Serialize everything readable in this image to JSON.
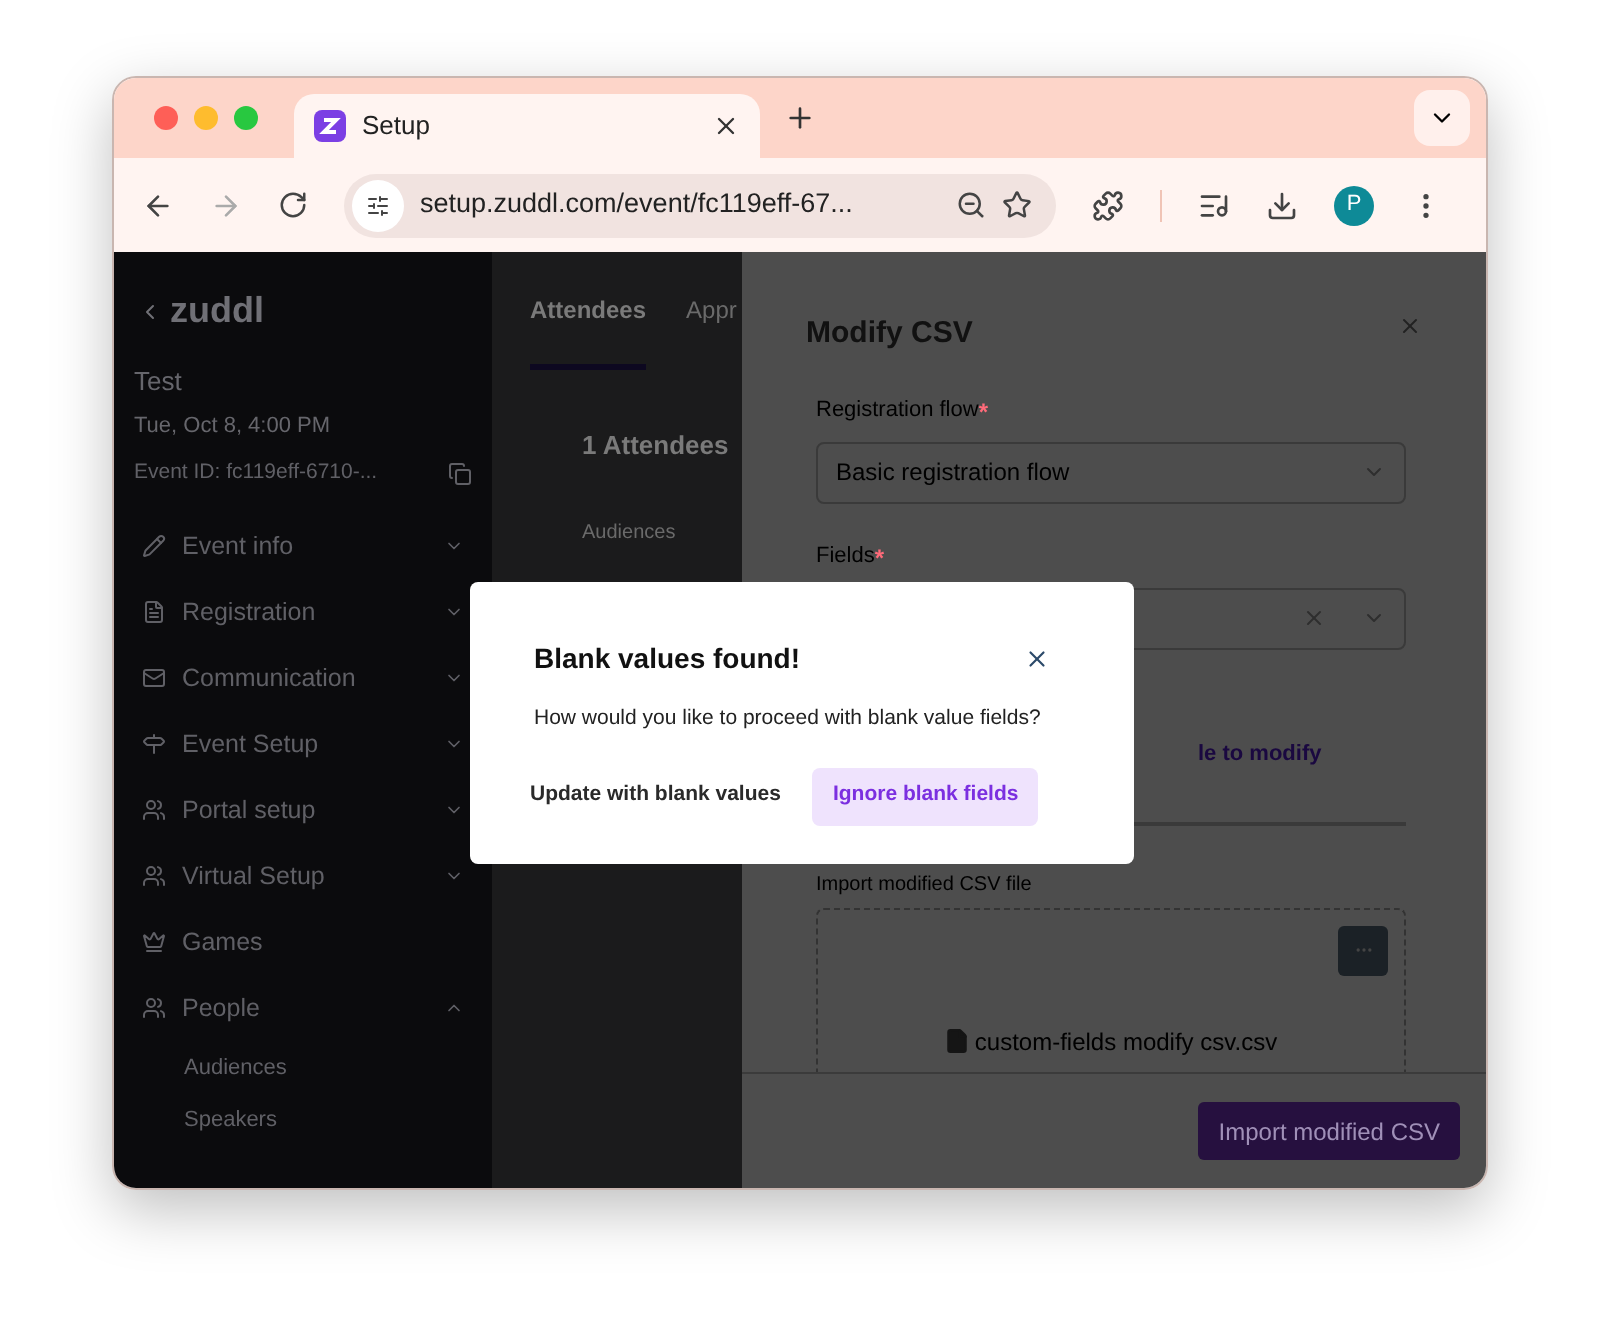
{
  "browser": {
    "tab": {
      "title": "Setup"
    },
    "address": "setup.zuddl.com/event/fc119eff-67...",
    "avatar": "P"
  },
  "sidebar": {
    "logo": "zuddl",
    "event": {
      "name": "Test",
      "date": "Tue, Oct 8, 4:00 PM",
      "id": "Event ID: fc119eff-6710-..."
    },
    "items": [
      {
        "label": "Event info",
        "kind": "group",
        "expanded": false
      },
      {
        "label": "Registration",
        "kind": "group",
        "expanded": false
      },
      {
        "label": "Communication",
        "kind": "group",
        "expanded": false
      },
      {
        "label": "Event Setup",
        "kind": "group",
        "expanded": false
      },
      {
        "label": "Portal setup",
        "kind": "group",
        "expanded": false
      },
      {
        "label": "Virtual Setup",
        "kind": "group",
        "expanded": false
      },
      {
        "label": "Games",
        "kind": "link"
      },
      {
        "label": "People",
        "kind": "group",
        "expanded": true,
        "children": [
          {
            "label": "Audiences"
          },
          {
            "label": "Speakers"
          }
        ]
      }
    ]
  },
  "main": {
    "tabs": [
      {
        "label": "Attendees",
        "selected": true
      },
      {
        "label": "Appr",
        "selected": false
      }
    ],
    "heading": "1 Attendees",
    "filter_label": "Audiences"
  },
  "drawer": {
    "title": "Modify CSV",
    "fields": [
      {
        "label": "Registration flow",
        "required_mark": "*",
        "value": "Basic registration flow",
        "clearable": false
      },
      {
        "label": "Fields",
        "required_mark": "*",
        "clearable": true
      }
    ],
    "link": "le to modify",
    "upload": {
      "label": "Import modified CSV file",
      "file_name": "custom-fields modify csv.csv"
    },
    "submit": "Import modified CSV"
  },
  "dialog": {
    "title": "Blank values found!",
    "message": "How would you like to proceed with blank value fields?",
    "buttons": [
      {
        "label": "Update with blank values",
        "kind": "secondary"
      },
      {
        "label": "Ignore blank fields",
        "kind": "primary"
      }
    ]
  }
}
